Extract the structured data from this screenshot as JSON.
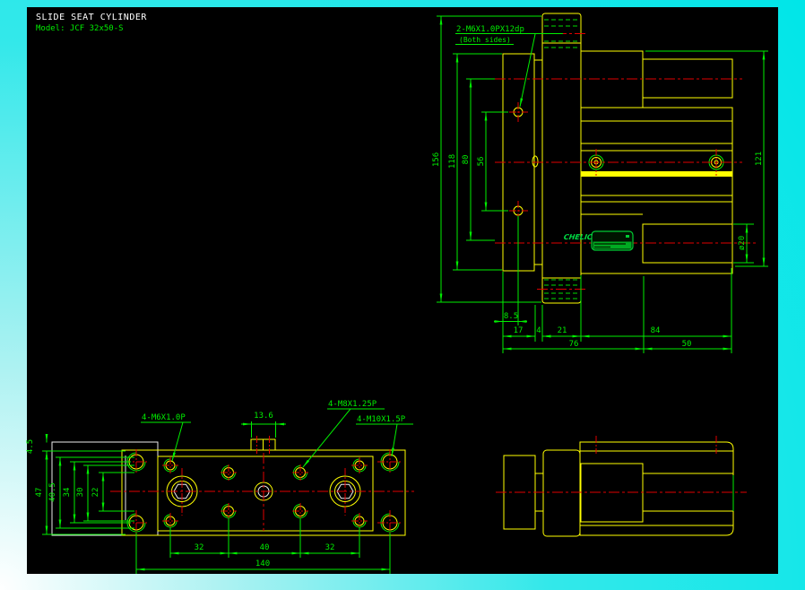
{
  "title_block": {
    "title": "SLIDE SEAT CYLINDER",
    "model": "Model: JCF 32x50-S"
  },
  "colors": {
    "outline": "#ffff00",
    "dimension": "#00ee00",
    "centerline": "#e00000",
    "background": "#000000",
    "frame": "#00e6e8"
  },
  "front_view": {
    "note1": "2-M6X1.0PX12dp",
    "note2": "(Both sides)",
    "d_total": "156",
    "d_plate": "118",
    "d_rods": "80",
    "d_holes": "56",
    "d_body": "121",
    "d_rod_dia": "ø20",
    "d_offset": "8.5",
    "d_17": "17",
    "d_4": "4",
    "d_21": "21",
    "d_84": "84",
    "d_76": "76",
    "d_50": "50"
  },
  "nameplate": {
    "brand": "CHELIC"
  },
  "plan_view": {
    "note_m6": "4-M6X1.0P",
    "note_m8": "4-M8X1.25P",
    "note_m10": "4-M10X1.5P",
    "d_tab": "13.6",
    "d_45": "4.5",
    "d_47": "47",
    "d_405": "40.5",
    "d_34": "34",
    "d_30": "30",
    "d_22": "22",
    "d_32a": "32",
    "d_40": "40",
    "d_32b": "32",
    "d_140": "140"
  }
}
